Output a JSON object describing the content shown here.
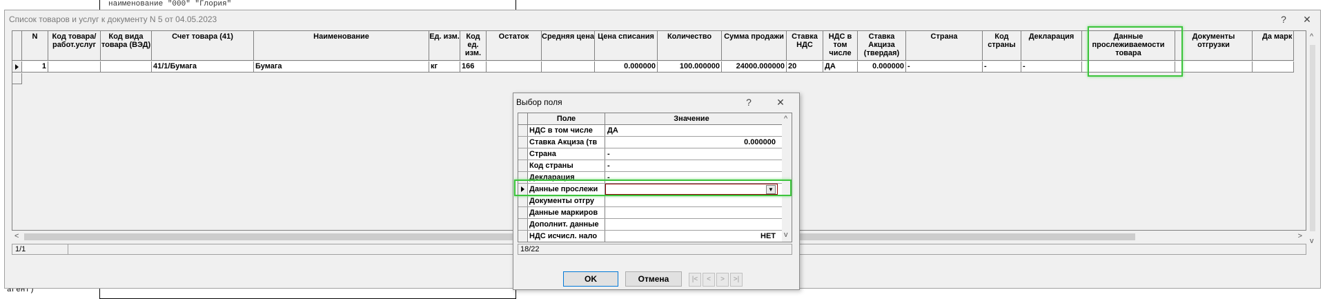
{
  "background": {
    "doc_text": "наименование \"000\" \"Глория\"",
    "left_text": "агент)"
  },
  "window": {
    "title": "Список товаров и услуг к документу N 5 от 04.05.2023",
    "help": "?",
    "close": "✕"
  },
  "grid": {
    "columns": [
      {
        "label": "N"
      },
      {
        "label": "Код товара/ работ.услуг"
      },
      {
        "label": "Код вида товара (ВЭД)"
      },
      {
        "label": "Счет товара (41)"
      },
      {
        "label": "Наименование"
      },
      {
        "label": "Ед. изм."
      },
      {
        "label": "Код ед. изм."
      },
      {
        "label": "Остаток"
      },
      {
        "label": "Средняя цена"
      },
      {
        "label": "Цена списания"
      },
      {
        "label": "Количество"
      },
      {
        "label": "Сумма продажи"
      },
      {
        "label": "Ставка НДС"
      },
      {
        "label": "НДС в том числе"
      },
      {
        "label": "Ставка Акциза (твердая)"
      },
      {
        "label": "Страна"
      },
      {
        "label": "Код страны"
      },
      {
        "label": "Декларация"
      },
      {
        "label": "Данные прослеживаемости товара"
      },
      {
        "label": "Документы отгрузки"
      },
      {
        "label": "Да марк"
      }
    ],
    "row": [
      "1",
      "",
      "",
      "41/1/Бумага",
      "Бумага",
      "кг",
      "166",
      "",
      "",
      "0.000000",
      "100.000000",
      "24000.000000",
      "20",
      "ДА",
      "0.000000",
      "-",
      "-",
      "-",
      "",
      "",
      ""
    ],
    "status": "1/1"
  },
  "dialog": {
    "title": "Выбор поля",
    "help": "?",
    "close": "✕",
    "col_field": "Поле",
    "col_value": "Значение",
    "rows": [
      {
        "field": "НДС в том числе",
        "value": "ДА"
      },
      {
        "field": "Ставка Акциза (тв",
        "value": "0.000000"
      },
      {
        "field": "Страна",
        "value": "-"
      },
      {
        "field": "Код страны",
        "value": "-"
      },
      {
        "field": "Декларация",
        "value": "-"
      },
      {
        "field": "Данные прослежи",
        "value": ""
      },
      {
        "field": "Документы отгру",
        "value": ""
      },
      {
        "field": "Данные маркиров",
        "value": ""
      },
      {
        "field": "Дополнит. данные",
        "value": ""
      },
      {
        "field": "НДС исчисл. нало",
        "value": "НЕТ"
      }
    ],
    "status": "18/22",
    "ok": "OK",
    "cancel": "Отмена",
    "nav": [
      "|<",
      "<",
      ">",
      ">|"
    ]
  },
  "colors": {
    "highlight": "#3cc43c",
    "edit_border": "#8b0000"
  }
}
